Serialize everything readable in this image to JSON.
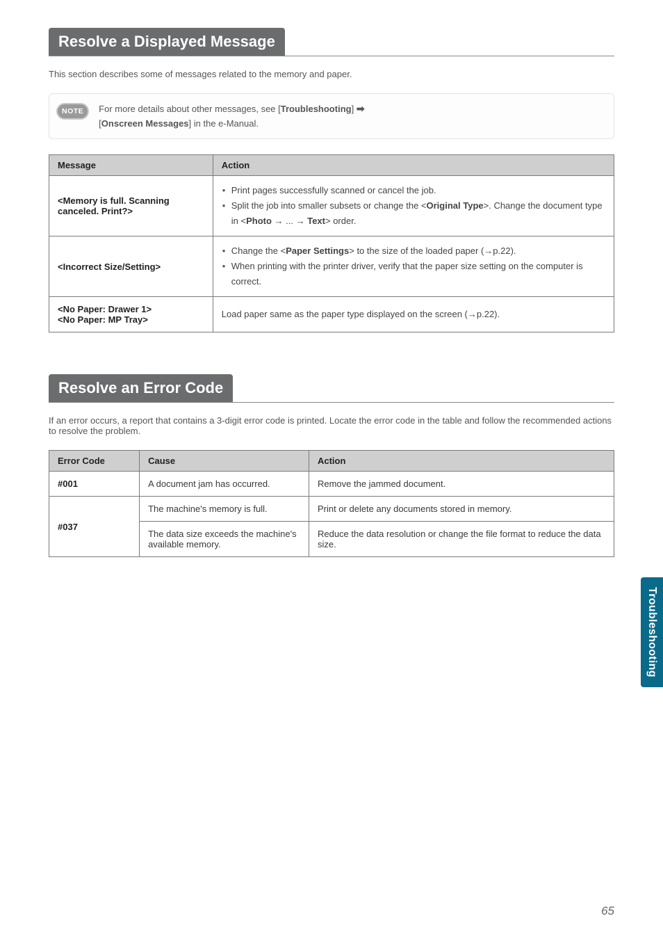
{
  "section1": {
    "title": "Resolve a Displayed Message",
    "intro": "This section describes some of messages related to the memory and paper.",
    "note_badge": "NOTE",
    "note_text_a": "For more details about other messages, see [",
    "note_text_b": "Troubleshooting",
    "note_text_c": "] ",
    "note_text_d": "[",
    "note_text_e": "Onscreen Messages",
    "note_text_f": "] in the e-Manual."
  },
  "table1": {
    "header_message": "Message",
    "header_action": "Action",
    "rows": [
      {
        "message": "<Memory is full. Scanning canceled. Print?>",
        "action_items": [
          "Print pages successfully scanned or cancel the job.",
          "Split the job into smaller subsets or change the <Original Type>. Change the document type in <Photo → ... → Text> order."
        ]
      },
      {
        "message": "<Incorrect Size/Setting>",
        "action_items": [
          "Change the <Paper Settings> to the size of the loaded paper (→p.22).",
          "When printing with the printer driver, verify that the paper size setting on the computer is correct."
        ]
      },
      {
        "message": "<No Paper: Drawer 1>\n<No Paper: MP Tray>",
        "action_plain": "Load paper same as the paper type displayed on the screen (→p.22)."
      }
    ]
  },
  "section2": {
    "title": "Resolve an Error Code",
    "intro": "If an error occurs, a report that contains a 3-digit error code is printed. Locate the error code in the table and follow the recommended actions to resolve the problem."
  },
  "table2": {
    "header_code": "Error Code",
    "header_cause": "Cause",
    "header_action": "Action",
    "rows": [
      {
        "code": "#001",
        "cause": "A document jam has occurred.",
        "action": "Remove the jammed document."
      },
      {
        "code": "#037",
        "cause": "The machine's memory is full.",
        "action": "Print or delete any documents stored in memory."
      },
      {
        "code": "",
        "cause": "The data size exceeds the machine's available memory.",
        "action": "Reduce the data resolution or change the file format to reduce the data size."
      }
    ]
  },
  "side_tab": "Troubleshooting",
  "page_number": "65"
}
